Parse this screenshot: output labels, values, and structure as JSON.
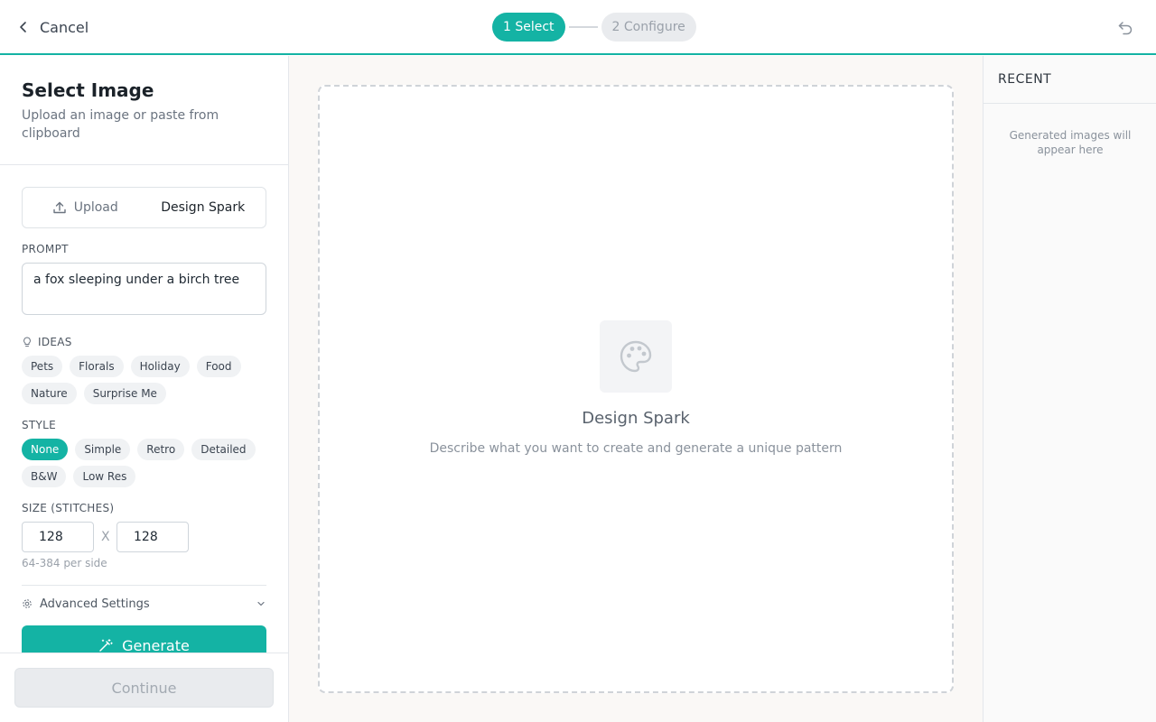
{
  "header": {
    "cancel_label": "Cancel",
    "steps": [
      {
        "number": "1",
        "label": "Select",
        "active": true
      },
      {
        "number": "2",
        "label": "Configure",
        "active": false
      }
    ],
    "step1_text": "1 Select",
    "step2_text": "2 Configure"
  },
  "left": {
    "title": "Select Image",
    "subtitle": "Upload an image or paste from clipboard",
    "tabs": {
      "upload": "Upload",
      "design_spark": "Design Spark"
    },
    "prompt": {
      "label": "PROMPT",
      "value": "a fox sleeping under a birch tree"
    },
    "ideas": {
      "label": "IDEAS",
      "items": [
        "Pets",
        "Florals",
        "Holiday",
        "Food",
        "Nature",
        "Surprise Me"
      ]
    },
    "style": {
      "label": "STYLE",
      "items": [
        "None",
        "Simple",
        "Retro",
        "Detailed",
        "B&W",
        "Low Res"
      ],
      "selected": "None"
    },
    "size": {
      "label": "SIZE (STITCHES)",
      "width": "128",
      "height": "128",
      "separator": "X",
      "hint": "64-384 per side"
    },
    "advanced_label": "Advanced Settings",
    "generate_label": "Generate",
    "continue_label": "Continue"
  },
  "canvas": {
    "title": "Design Spark",
    "subtitle": "Describe what you want to create and generate a unique pattern"
  },
  "right": {
    "header": "RECENT",
    "empty_text": "Generated images will appear here"
  },
  "colors": {
    "accent": "#14b3a4",
    "canvas_bg": "#faf8f6",
    "disabled_bg": "#e9ebee"
  }
}
